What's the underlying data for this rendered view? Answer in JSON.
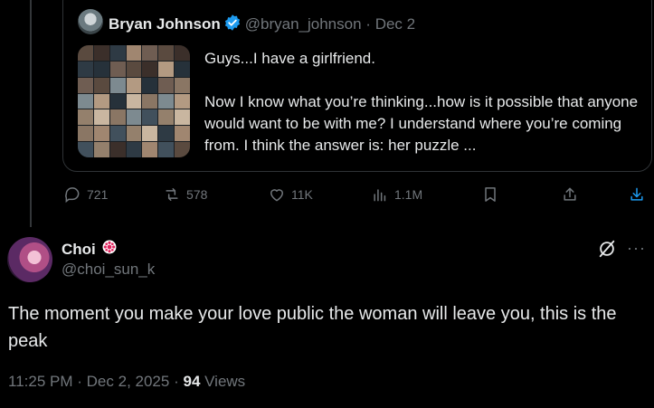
{
  "quoted_tweet": {
    "author_name": "Bryan Johnson",
    "author_handle": "@bryan_johnson",
    "separator": "·",
    "date": "Dec 2",
    "text": "Guys...I have a girlfriend.\n\nNow I know what you’re thinking...how is it possible that anyone would want to be with me? I understand where you’re coming from. I think the answer is: her puzzle ..."
  },
  "actions": {
    "replies": "721",
    "reposts": "578",
    "likes": "11K",
    "views": "1.1M"
  },
  "reply": {
    "author_name": "Choi",
    "author_handle": "@choi_sun_k",
    "more_label": "···",
    "text": "The moment you make your love public the woman will leave you, this is the peak",
    "time": "11:25 PM",
    "separator": "·",
    "date": "Dec 2, 2025",
    "separator2": "·",
    "views_count": "94",
    "views_label": "Views"
  },
  "colors": {
    "background": "#000000",
    "text_primary": "#e7e9ea",
    "text_secondary": "#71767b",
    "border": "#2f3336",
    "verified_blue": "#1d9bf0",
    "badge_red": "#e0245e"
  }
}
